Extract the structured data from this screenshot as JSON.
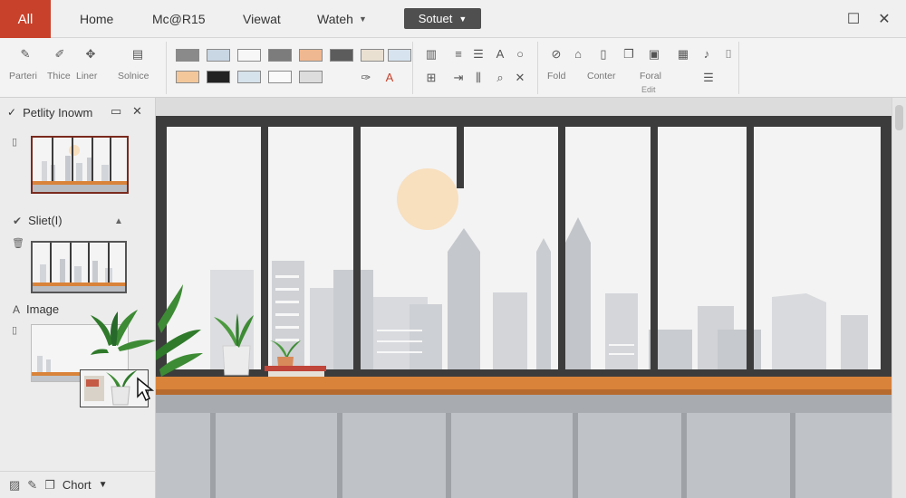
{
  "menubar": {
    "app_tab": "All",
    "items": [
      "Home",
      "Mc@R15",
      "Viewat",
      "Wateh"
    ],
    "dropdown": "Sotuet"
  },
  "ribbon": {
    "labels": [
      "Parteri",
      "Thice",
      "Liner",
      "Solnice"
    ],
    "group_caption_right": "Fold",
    "group_caption_center": "Conter",
    "group_caption_format": "Foral",
    "group_caption_edit": "Edit"
  },
  "left_panel": {
    "title": "Petlity Inowm",
    "section_slides": "Sliet(I)",
    "section_image": "Image",
    "footer": "Chort"
  },
  "colors": {
    "accent": "#c8412b",
    "sun": "#f8dfbe",
    "shelf": "#d9833a",
    "frame": "#3c3c3c"
  }
}
